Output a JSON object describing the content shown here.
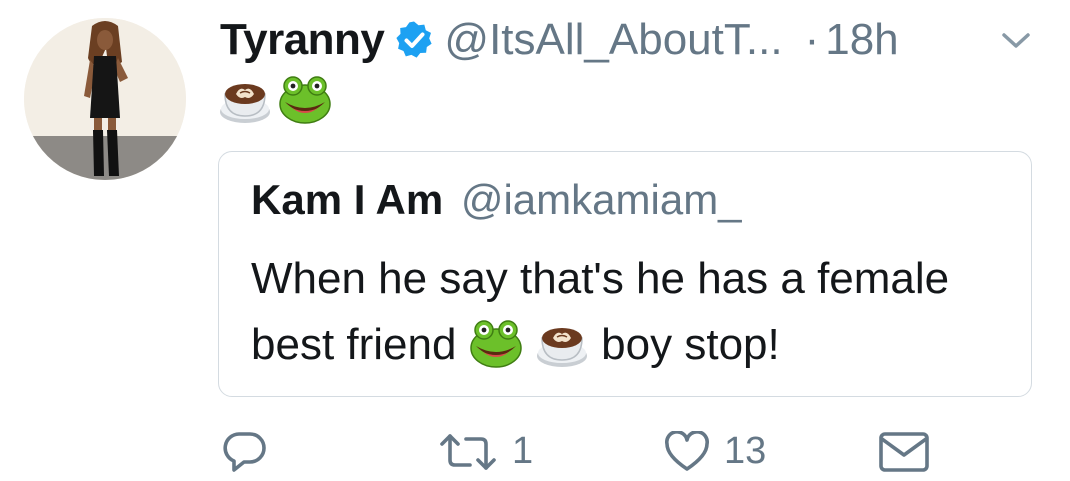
{
  "tweet": {
    "display_name": "Tyranny",
    "handle": "@ItsAll_AboutT...",
    "separator": "·",
    "time": "18h",
    "body_emoji": [
      "coffee-latte-emoji",
      "frog-face-emoji"
    ]
  },
  "quoted_tweet": {
    "display_name": "Kam I Am",
    "handle": "@iamkamiam_",
    "text_part1": "When he say that's he has a female best friend",
    "text_part2": "boy stop!"
  },
  "actions": {
    "reply_count": "",
    "retweet_count": "1",
    "like_count": "13"
  },
  "colors": {
    "text_primary": "#14171a",
    "text_secondary": "#657786",
    "verified_blue": "#1da1f2",
    "quote_border": "#d4dbe1"
  },
  "icons": [
    "verified-badge-icon",
    "chevron-down-icon",
    "reply-icon",
    "retweet-icon",
    "like-icon",
    "direct-message-icon"
  ]
}
